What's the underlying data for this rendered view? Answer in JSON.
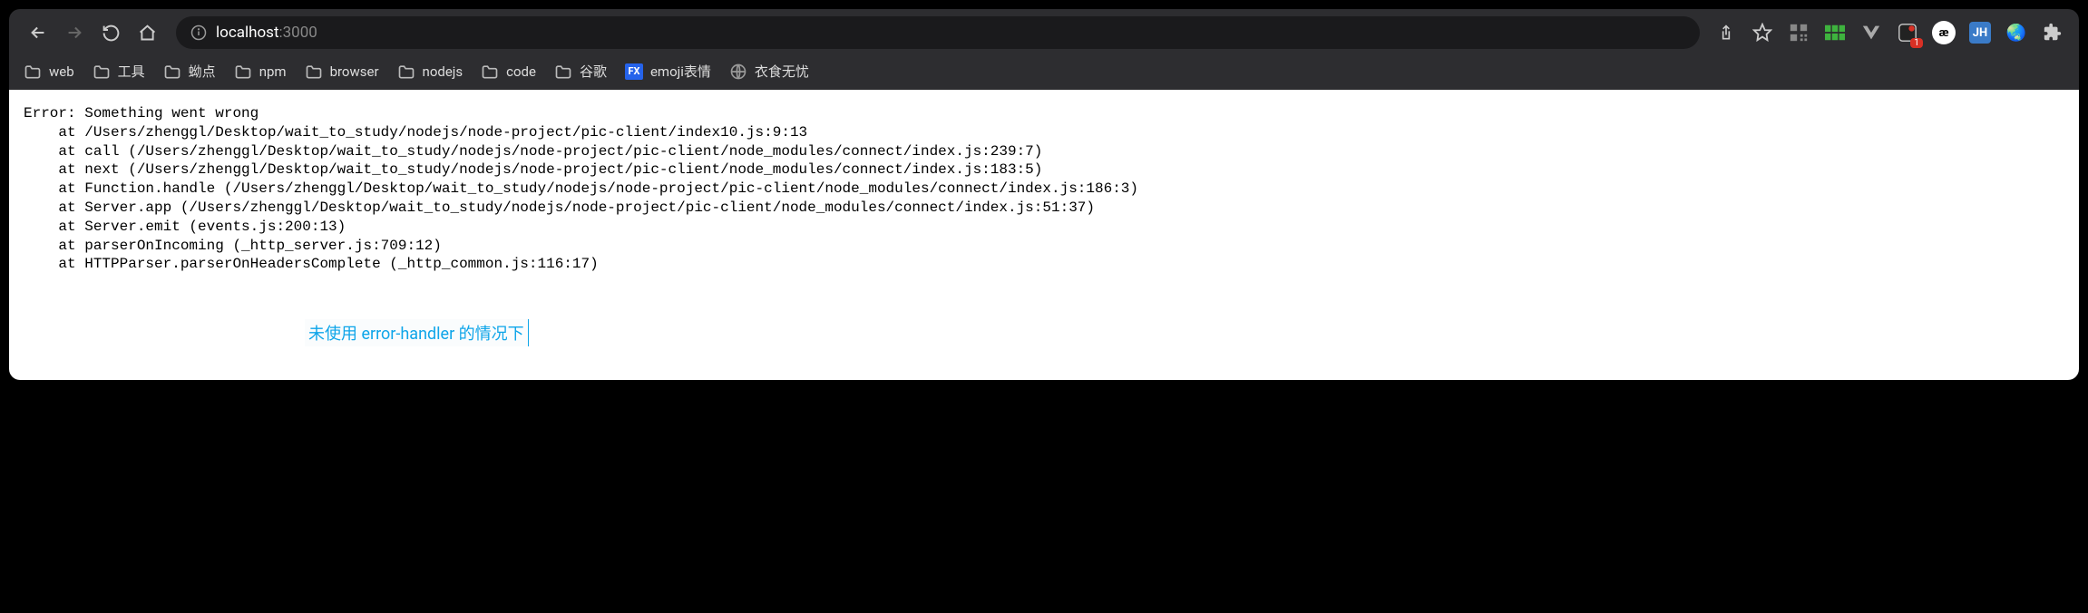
{
  "address": {
    "host": "localhost",
    "port": ":3000"
  },
  "nav": {
    "back": "Back",
    "forward": "Forward",
    "reload": "Reload",
    "home": "Home",
    "info": "View site information",
    "share": "Share",
    "bookmark": "Bookmark"
  },
  "extensions": {
    "qr": "QR",
    "grid": "Grid",
    "vue": "Vue",
    "flag": "Flag",
    "ae": "æ",
    "jh": "JH",
    "globe": "🌏",
    "puzzle": "Extensions",
    "badge_count": "1"
  },
  "bookmarks": [
    {
      "type": "folder",
      "label": "web"
    },
    {
      "type": "folder",
      "label": "工具"
    },
    {
      "type": "folder",
      "label": "蚴点"
    },
    {
      "type": "folder",
      "label": "npm"
    },
    {
      "type": "folder",
      "label": "browser"
    },
    {
      "type": "folder",
      "label": "nodejs"
    },
    {
      "type": "folder",
      "label": "code"
    },
    {
      "type": "folder",
      "label": "谷歌"
    },
    {
      "type": "fx",
      "label": "emoji表情"
    },
    {
      "type": "globe",
      "label": "衣食无忧"
    }
  ],
  "error": {
    "title": "Error: Something went wrong",
    "stack": [
      "    at /Users/zhenggl/Desktop/wait_to_study/nodejs/node-project/pic-client/index10.js:9:13",
      "    at call (/Users/zhenggl/Desktop/wait_to_study/nodejs/node-project/pic-client/node_modules/connect/index.js:239:7)",
      "    at next (/Users/zhenggl/Desktop/wait_to_study/nodejs/node-project/pic-client/node_modules/connect/index.js:183:5)",
      "    at Function.handle (/Users/zhenggl/Desktop/wait_to_study/nodejs/node-project/pic-client/node_modules/connect/index.js:186:3)",
      "    at Server.app (/Users/zhenggl/Desktop/wait_to_study/nodejs/node-project/pic-client/node_modules/connect/index.js:51:37)",
      "    at Server.emit (events.js:200:13)",
      "    at parserOnIncoming (_http_server.js:709:12)",
      "    at HTTPParser.parserOnHeadersComplete (_http_common.js:116:17)"
    ]
  },
  "annotation": "未使用 error-handler 的情况下"
}
